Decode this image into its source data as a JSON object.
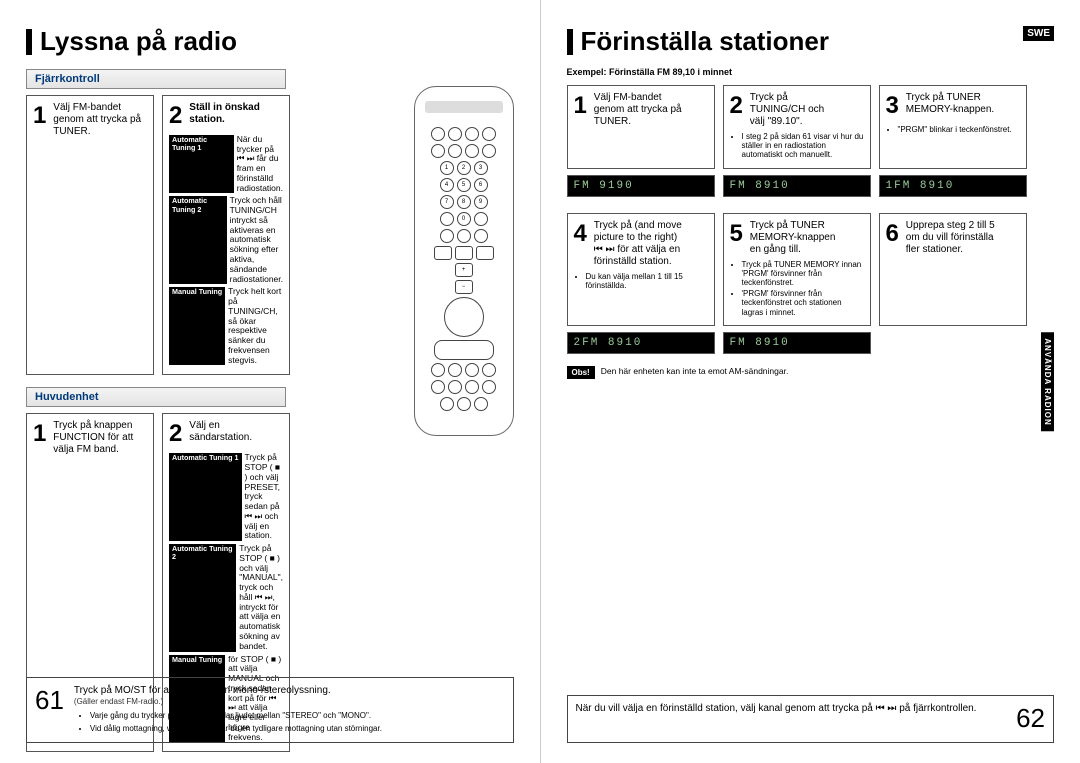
{
  "left": {
    "title": "Lyssna på radio",
    "sections": {
      "remote_label": "Fjärrkontroll",
      "main_unit_label": "Huvudenhet"
    },
    "remote_steps": {
      "s1": "Välj FM-bandet genom att trycka på TUNER.",
      "s2": "Ställ in önskad station."
    },
    "tuning_labels": {
      "auto1": "Automatic Tuning 1",
      "auto2": "Automatic Tuning 2",
      "manual": "Manual Tuning"
    },
    "remote_notes": {
      "a1": "När du trycker på ⏮ ⏭ får du fram en förinställd radiostation.",
      "a2": "Tryck och håll TUNING/CH intryckt så aktiveras en automatisk sökning efter aktiva, sändande radiostationer.",
      "m": "Tryck helt kort på TUNING/CH, så ökar respektive sänker du frekvensen stegvis."
    },
    "main_steps": {
      "s1": "Tryck på knappen FUNCTION för att välja FM band.",
      "s2": "Välj en sändarstation."
    },
    "main_notes": {
      "a1": "Tryck på STOP ( ■ ) och välj PRESET, tryck sedan på ⏮ ⏭ och välj en station.",
      "a2": "Tryck på STOP ( ■ ) och välj \"MANUAL\", tryck och håll ⏮ ⏭, intryckt för att välja en automatisk sökning av bandet.",
      "m": "för STOP ( ■ ) att välja MANUAL och tryck sedan kort på för ⏮ ⏭ att välja lägre eller högre frekvens."
    },
    "footer": {
      "main": "Tryck på MO/ST för att välja mellan mono-/stereolyssning.",
      "sub": "(Gäller endast FM-radio.)",
      "b1": "Varje gång du trycker på knappen växlar ljudet mellan \"STEREO\" och \"MONO\".",
      "b2": "Vid dålig mottagning, välj MONO så får du en tydligare mottagning utan störningar."
    },
    "page_number": "61"
  },
  "right": {
    "title": "Förinställa stationer",
    "swe": "SWE",
    "example": "Exempel: Förinställa FM 89,10 i minnet",
    "steps": {
      "s1": "Välj FM-bandet genom att trycka på TUNER.",
      "s2": "Tryck på TUNING/CH och välj \"89.10\".",
      "s3": "Tryck på TUNER MEMORY-knappen.",
      "s4": "Tryck på (and move picture to the right) ⏮ ⏭ för att välja en förinställd station.",
      "s5": "Tryck på TUNER MEMORY-knappen en gång till.",
      "s6": "Upprepa steg 2 till 5 om du vill förinställa fler stationer."
    },
    "notes": {
      "n2": "I steg 2 på sidan 61 visar vi hur du ställer in en radiostation automatiskt och manuellt.",
      "n3": "\"PRGM\" blinkar i teckenfönstret.",
      "n4": "Du kan välja mellan 1 till 15 förinställda.",
      "n5a": "Tryck på TUNER MEMORY innan 'PRGM' försvinner från teckenfönstret.",
      "n5b": "'PRGM' försvinner från teckenfönstret och stationen lagras i minnet."
    },
    "lcd": {
      "d1": "FM   9190",
      "d2": "FM   8910",
      "d3": "1FM  8910",
      "d4": "2FM  8910",
      "d5": "FM   8910"
    },
    "obs": {
      "label": "Obs!",
      "text": "Den här enheten kan inte ta emot AM-sändningar."
    },
    "footer": {
      "main": "När du vill välja en förinställd station, välj kanal genom att trycka på ⏮ ⏭ på fjärrkontrollen."
    },
    "side_tab": "ANVÄNDA RADION",
    "page_number": "62"
  }
}
